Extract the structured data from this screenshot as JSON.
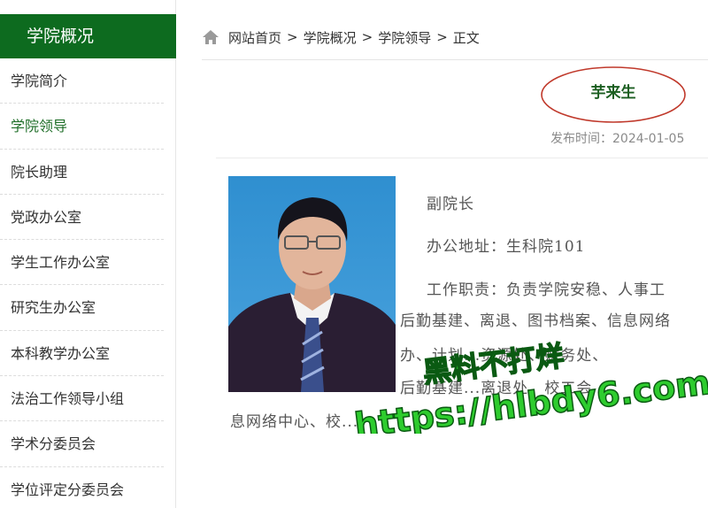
{
  "sidebar": {
    "title": "学院概况",
    "items": [
      {
        "label": "学院简介"
      },
      {
        "label": "学院领导"
      },
      {
        "label": "院长助理"
      },
      {
        "label": "党政办公室"
      },
      {
        "label": "学生工作办公室"
      },
      {
        "label": "研究生办公室"
      },
      {
        "label": "本科教学办公室"
      },
      {
        "label": "法治工作领导小组"
      },
      {
        "label": "学术分委员会"
      },
      {
        "label": "学位评定分委员会"
      }
    ],
    "active_index": 1,
    "head_color": "#0d6b1f",
    "active_color": "#1f6e28"
  },
  "breadcrumb": {
    "home_icon": "home-icon",
    "items": [
      "网站首页",
      "学院概况",
      "学院领导",
      "正文"
    ],
    "separator": ">"
  },
  "article": {
    "title": "芋来生",
    "date": "发布时间：2024-01-05",
    "position": "副院长",
    "office": "办公地址：生科院101",
    "duties_line1": "工作职责：负责学院安稳、人事工",
    "duties_line2": "后勤基建、离退、图书档案、信息网络",
    "duties_line3": "办、计划...资源处、财务处、",
    "duties_line4": "后勤基建...离退处、校工会",
    "duties_line5": "息网络中心、校...",
    "title_ring_color": "#c0392b"
  },
  "watermark": {
    "line1": "黑料不打烊",
    "line2": "https://hlbdy6.com",
    "color": "#2ecc2e"
  }
}
